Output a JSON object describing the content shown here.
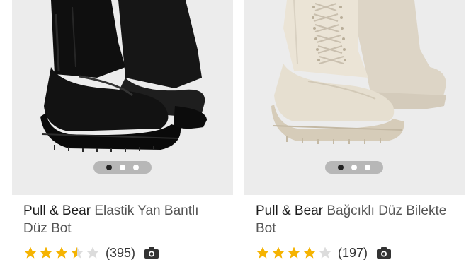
{
  "products": [
    {
      "brand": "Pull & Bear",
      "name": "Elastik Yan Bantlı Düz Bot",
      "rating": 3.5,
      "rating_max": 5,
      "review_count": "(395)",
      "image_dots": 3,
      "active_dot": 1,
      "icons": {
        "review_photo": "camera-icon",
        "rating": "star-icon"
      }
    },
    {
      "brand": "Pull & Bear",
      "name": "Bağcıklı Düz Bilekte Bot",
      "rating": 4,
      "rating_max": 5,
      "review_count": "(197)",
      "image_dots": 3,
      "active_dot": 1,
      "icons": {
        "review_photo": "camera-icon",
        "rating": "star-icon"
      }
    }
  ],
  "colors": {
    "star_filled": "#f5b301",
    "star_empty": "#dcdcdc",
    "image_bg": "#ececec"
  }
}
